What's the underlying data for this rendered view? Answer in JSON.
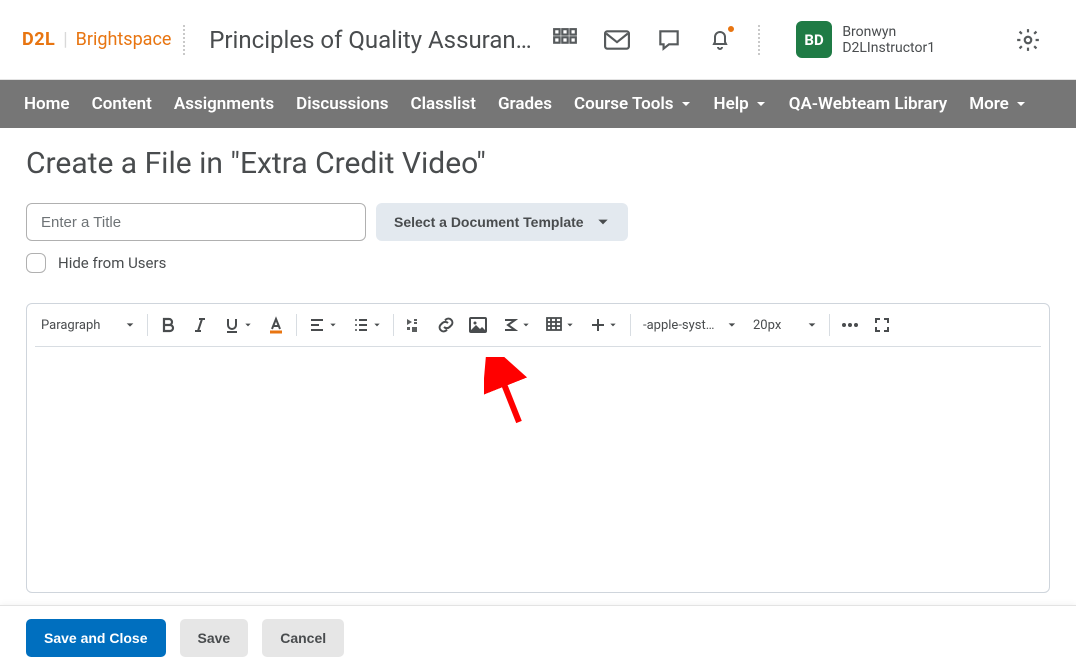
{
  "header": {
    "logo1": "D2L",
    "logo2": "Brightspace",
    "course_title": "Principles of Quality Assuranc…",
    "avatar_initials": "BD",
    "username": "Bronwyn D2LInstructor1"
  },
  "nav": {
    "items": [
      "Home",
      "Content",
      "Assignments",
      "Discussions",
      "Classlist",
      "Grades",
      "Course Tools",
      "Help",
      "QA-Webteam Library",
      "More"
    ],
    "dropdown": [
      false,
      false,
      false,
      false,
      false,
      false,
      true,
      true,
      false,
      true
    ]
  },
  "page": {
    "title": "Create a File in \"Extra Credit Video\"",
    "title_placeholder": "Enter a Title",
    "template_button": "Select a Document Template",
    "hide_label": "Hide from Users"
  },
  "toolbar": {
    "format": "Paragraph",
    "font": "-apple-syste…",
    "size": "20px"
  },
  "footer": {
    "save_close": "Save and Close",
    "save": "Save",
    "cancel": "Cancel"
  },
  "colors": {
    "brand": "#e87511",
    "primary": "#006fbf",
    "avatar": "#1f7b45",
    "arrow": "#ff0000"
  }
}
